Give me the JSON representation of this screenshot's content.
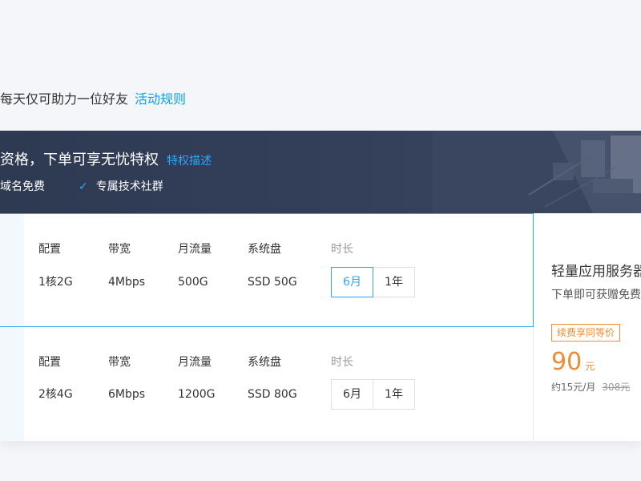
{
  "notice": {
    "text": "每天仅可助力一位好友",
    "link": "活动规则"
  },
  "banner": {
    "title": "资格，下单可享无忧特权",
    "subtitle_link": "特权描述",
    "perks": [
      "域名免费",
      "专属技术社群"
    ]
  },
  "plans": [
    {
      "headers": [
        "配置",
        "带宽",
        "月流量",
        "系统盘",
        "时长"
      ],
      "values": [
        "1核2G",
        "4Mbps",
        "500G",
        "SSD 50G"
      ],
      "durations": [
        "6月",
        "1年"
      ],
      "selected_duration": "6月"
    },
    {
      "headers": [
        "配置",
        "带宽",
        "月流量",
        "系统盘",
        "时长"
      ],
      "values": [
        "2核4G",
        "6Mbps",
        "1200G",
        "SSD 80G"
      ],
      "durations": [
        "6月",
        "1年"
      ],
      "selected_duration": ""
    }
  ],
  "side": {
    "title": "轻量应用服务器",
    "subtitle": "下单即可获赠免费",
    "badge": "续费享同等价",
    "price": "90",
    "price_unit": "元",
    "monthly": "约15元/月",
    "original": "308元"
  },
  "colors": {
    "accent": "#2aa7ff",
    "link": "#0aa1ed",
    "price": "#f28a30",
    "banner_bg": "#2e3a52"
  }
}
